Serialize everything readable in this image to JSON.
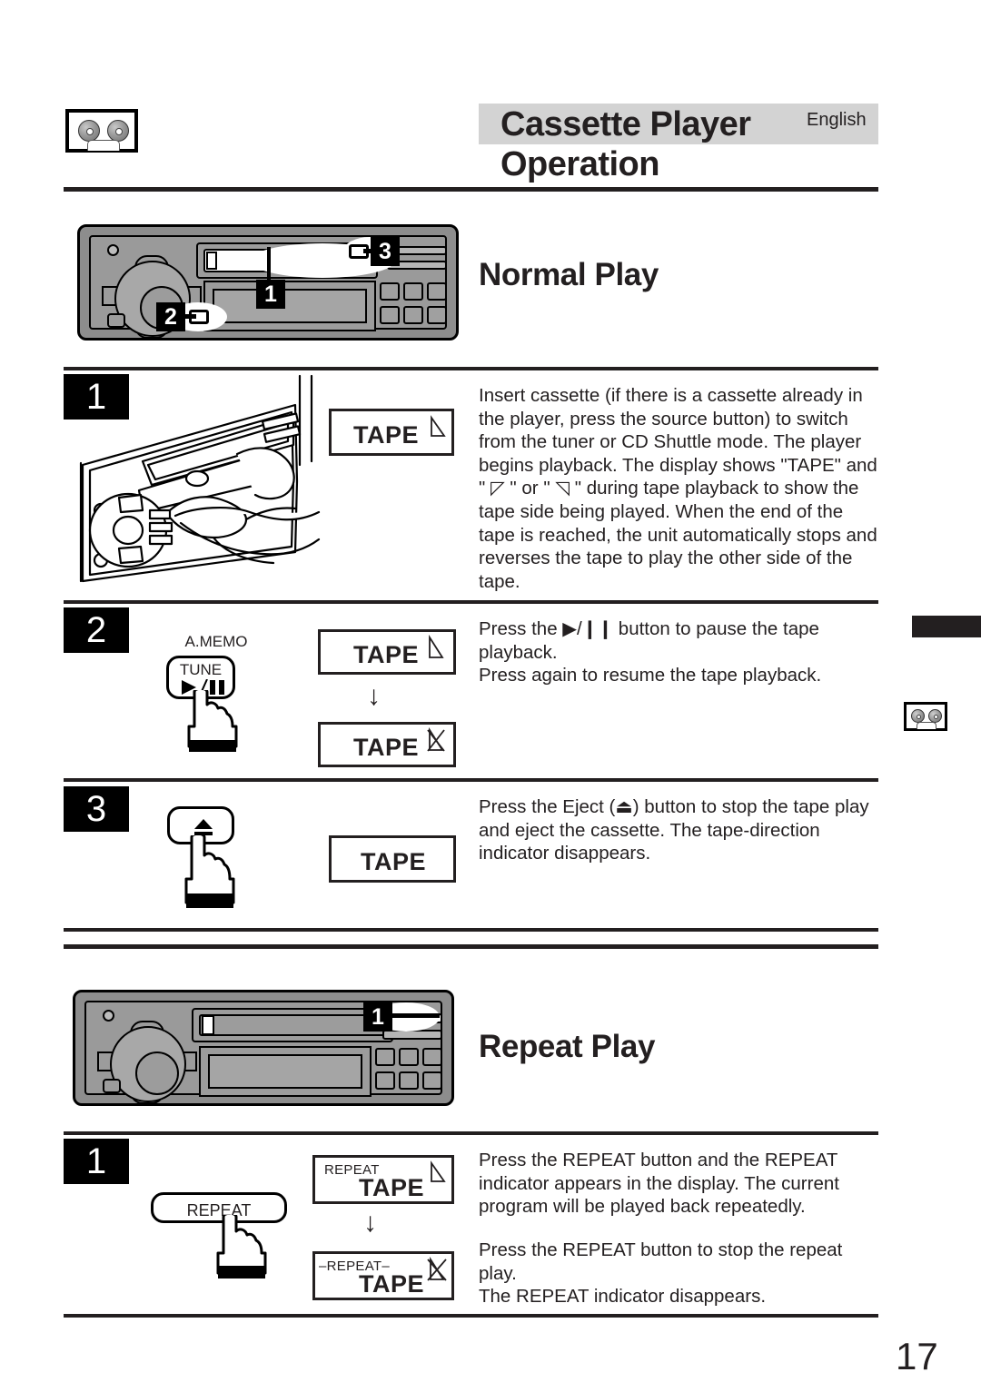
{
  "header": {
    "title_line1": "Cassette Player",
    "title_line2": "Operation",
    "language": "English",
    "cassette_icon": "cassette-tape-icon"
  },
  "sections": {
    "normal_play": {
      "heading": "Normal Play",
      "faceplate_callouts": [
        "1",
        "2",
        "3"
      ]
    },
    "repeat_play": {
      "heading": "Repeat Play",
      "faceplate_callouts": [
        "1"
      ]
    }
  },
  "normal_play_steps": [
    {
      "number": "1",
      "illustration": "hand-inserting-cassette-illustration",
      "display": {
        "tape_label": "TAPE",
        "indicator": "tape-direction-forward-triangle"
      },
      "text": "Insert cassette (if there is a cassette already in the player, press the source button) to switch from the tuner or CD Shuttle mode. The player begins playback. The display shows \"TAPE\" and \" ◸ \" or \" ◹ \" during tape playback to show the tape side being played. When the end of the tape is reached, the unit automatically stops and reverses the tape to play the other side of the tape."
    },
    {
      "number": "2",
      "button": {
        "top_label": "A.MEMO",
        "face_label": "TUNE",
        "glyph": "play-pause-icon"
      },
      "display_before": {
        "tape_label": "TAPE",
        "indicator": "tape-direction-forward-triangle"
      },
      "transition_arrow": "↓",
      "display_after": {
        "tape_label": "TAPE",
        "indicator": "tape-direction-blinking-triangle"
      },
      "text": "Press the ▶/❙❙ button to pause the tape playback.\nPress again to resume the tape playback."
    },
    {
      "number": "3",
      "button": {
        "glyph": "eject-icon"
      },
      "display": {
        "tape_label": "TAPE",
        "indicator": "none"
      },
      "text": "Press the Eject (⏏) button to stop the tape play and eject the cassette. The tape-direction indicator disappears."
    }
  ],
  "repeat_play_steps": [
    {
      "number": "1",
      "button": {
        "face_label": "REPEAT"
      },
      "display_before": {
        "repeat_label": "REPEAT",
        "tape_label": "TAPE",
        "indicator": "tape-direction-forward-triangle"
      },
      "transition_arrow": "↓",
      "display_after": {
        "repeat_label": "REPEAT",
        "tape_label": "TAPE",
        "indicator": "tape-direction-blinking-triangle"
      },
      "text_part1": "Press the REPEAT button and the REPEAT indicator appears in the display. The current program will be played back repeatedly.",
      "text_part2": "Press the REPEAT button to stop the repeat play.\nThe REPEAT indicator disappears."
    }
  ],
  "footer": {
    "page_number": "17"
  },
  "colors": {
    "ink": "#231f20",
    "header_band": "#d3d3d3",
    "faceplate": "#8d8d8d"
  }
}
